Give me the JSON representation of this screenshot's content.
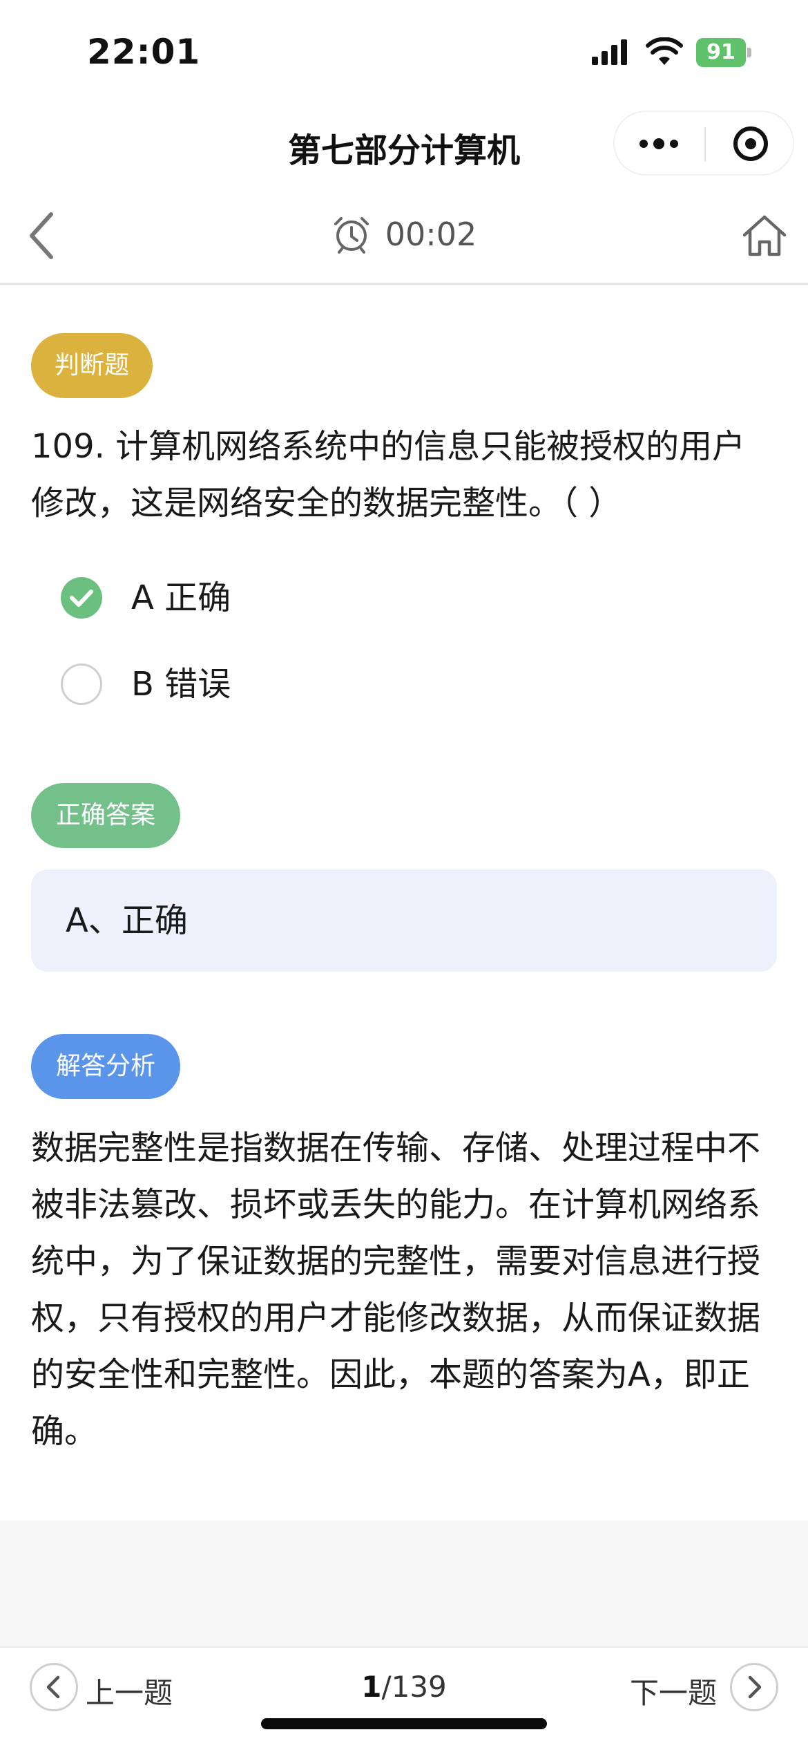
{
  "status_bar": {
    "time": "22:01",
    "battery": "91"
  },
  "title_bar": {
    "title": "第七部分计算机"
  },
  "nav": {
    "timer": "00:02"
  },
  "question": {
    "type_tag": "判断题",
    "text": "109. 计算机网络系统中的信息只能被授权的用户修改，这是网络安全的数据完整性。（ ）",
    "options": [
      {
        "label": "A 正确",
        "selected": true
      },
      {
        "label": "B 错误",
        "selected": false
      }
    ]
  },
  "answer": {
    "tag": "正确答案",
    "text": "A、正确"
  },
  "analysis": {
    "tag": "解答分析",
    "text": "数据完整性是指数据在传输、存储、处理过程中不被非法篡改、损坏或丢失的能力。在计算机网络系统中，为了保证数据的完整性，需要对信息进行授权，只有授权的用户才能修改数据，从而保证数据的安全性和完整性。因此，本题的答案为A，即正确。"
  },
  "footer": {
    "prev_label": "上一题",
    "next_label": "下一题",
    "current_page": "1",
    "total_pages": "/139"
  },
  "colors": {
    "type_tag": "#dbb23e",
    "answer_tag": "#74c08a",
    "analysis_tag": "#5b95ea",
    "answer_box": "#eef1fb",
    "selected_radio": "#6bbf7f",
    "battery": "#5fc26b"
  }
}
